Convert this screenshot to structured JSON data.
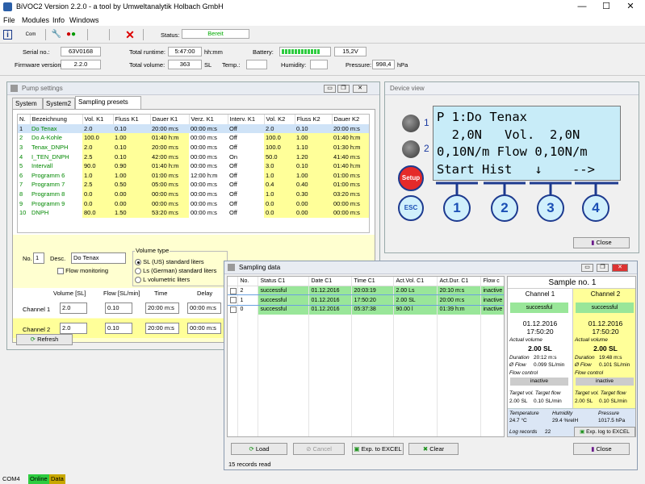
{
  "app": {
    "title": "BiVOC2 Version 2.2.0  - a tool by Umweltanalytik Holbach GmbH"
  },
  "menu": [
    "File",
    "Modules",
    "Info",
    "Windows"
  ],
  "toolbar": {
    "status_label": "Status:",
    "status_value": "Bereit",
    "com_label": "Com"
  },
  "info": {
    "serial_label": "Serial no.:",
    "serial": "63V0168",
    "firmware_label": "Firmware version:",
    "firmware": "2.2.0",
    "runtime_label": "Total runtime:",
    "runtime": "5:47:00",
    "runtime_unit": "hh:mm",
    "volume_label": "Total volume:",
    "volume": "363",
    "volume_unit": "SL",
    "battery_label": "Battery:",
    "battery_voltage": "15,2V",
    "battery_level": 0.82,
    "temp_label": "Temp.:",
    "humidity_label": "Humidity:",
    "pressure_label": "Pressure:",
    "pressure": "998,4",
    "pressure_unit": "hPa"
  },
  "pump": {
    "title": "Pump settings",
    "tabs": [
      "System",
      "System2",
      "Sampling presets"
    ],
    "headers": [
      "N.",
      "Bezeichnung",
      "Vol. K1",
      "Fluss K1",
      "Dauer K1",
      "Verz. K1",
      "Interv. K1",
      "Vol. K2",
      "Fluss K2",
      "Dauer K2"
    ],
    "rows": [
      [
        "1",
        "Do Tenax",
        "2.0",
        "0.10",
        "20:00 m:s",
        "00:00 m:s",
        "Off",
        "2.0",
        "0.10",
        "20:00 m:s"
      ],
      [
        "2",
        "Do A-Kohle",
        "100.0",
        "1.00",
        "01:40 h:m",
        "00:00 m:s",
        "Off",
        "100.0",
        "1.00",
        "01:40 h:m"
      ],
      [
        "3",
        "Tenax_DNPH",
        "2.0",
        "0.10",
        "20:00 m:s",
        "00:00 m:s",
        "Off",
        "100.0",
        "1.10",
        "01:30 h:m"
      ],
      [
        "4",
        "I_TEN_DNPH",
        "2.5",
        "0.10",
        "42:00 m:s",
        "00:00 m:s",
        "On",
        "50.0",
        "1.20",
        "41:40 m:s"
      ],
      [
        "5",
        "Intervall",
        "90.0",
        "0.90",
        "01:40 h:m",
        "00:00 m:s",
        "Off",
        "3.0",
        "0.10",
        "01:40 h:m"
      ],
      [
        "6",
        "Programm 6",
        "1.0",
        "1.00",
        "01:00 m:s",
        "12:00 h:m",
        "Off",
        "1.0",
        "1.00",
        "01:00 m:s"
      ],
      [
        "7",
        "Programm 7",
        "2.5",
        "0.50",
        "05:00 m:s",
        "00:00 m:s",
        "Off",
        "0.4",
        "0.40",
        "01:00 m:s"
      ],
      [
        "8",
        "Programm 8",
        "0.0",
        "0.00",
        "00:00 m:s",
        "00:00 m:s",
        "Off",
        "1.0",
        "0.30",
        "03:20 m:s"
      ],
      [
        "9",
        "Programm 9",
        "0.0",
        "0.00",
        "00:00 m:s",
        "00:00 m:s",
        "Off",
        "0.0",
        "0.00",
        "00:00 m:s"
      ],
      [
        "10",
        "DNPH",
        "80.0",
        "1.50",
        "53:20 m:s",
        "00:00 m:s",
        "Off",
        "0.0",
        "0.00",
        "00:00 m:s"
      ]
    ],
    "no_label": "No.",
    "no_value": "1",
    "desc_label": "Desc.",
    "desc_value": "Do Tenax",
    "flow_monitoring": "Flow monitoring",
    "voltype_label": "Volume type",
    "voltypes": [
      "SL (US) standard liters",
      "Ls (German) standard liters",
      "L  volumetric liters"
    ],
    "grid_headers": [
      "Volume  [SL]",
      "Flow [SL/min]",
      "Time",
      "Delay"
    ],
    "ch1_label": "Channel 1",
    "ch1": [
      "2.0",
      "0.10",
      "20:00 m:s",
      "00:00 m:s"
    ],
    "ch2_label": "Channel 2",
    "ch2": [
      "2.0",
      "0.10",
      "20:00 m:s",
      "00:00 m:s"
    ],
    "refresh": "Refresh"
  },
  "device": {
    "title": "Device view",
    "lcd": [
      "P 1:Do Tenax",
      "  2,0N   Vol.  2,0N",
      "0,10N/m Flow 0,10N/m",
      "Start Hist   ↓    -->"
    ],
    "led1": "1",
    "led2": "2",
    "setup": "Setup",
    "esc": "ESC",
    "buttons": [
      "1",
      "2",
      "3",
      "4"
    ],
    "close": "Close"
  },
  "sampling": {
    "title": "Sampling data",
    "headers": [
      "No.",
      "Status C1",
      "Date C1",
      "Time C1",
      "Act.Vol. C1",
      "Act.Dur. C1",
      "Flow c"
    ],
    "rows": [
      [
        "2",
        "successful",
        "01.12.2016",
        "20:03:19",
        "2.00 Ls",
        "20:10 m:s",
        "inactive"
      ],
      [
        "1",
        "successful",
        "01.12.2016",
        "17:50:20",
        "2.00 SL",
        "20:00 m:s",
        "inactive"
      ],
      [
        "0",
        "successful",
        "01.12.2016",
        "05:37:38",
        "90.00 l",
        "01:39 h:m",
        "inactive"
      ]
    ],
    "load": "Load",
    "cancel": "Cancel",
    "excel": "Exp. to EXCEL",
    "clear": "Clear",
    "records": "15 records read",
    "sample_title": "Sample no. 1",
    "ch1": {
      "name": "Channel 1",
      "status": "successful",
      "date": "01.12.2016",
      "time": "17:50:20",
      "actvol_label": "Actual volume",
      "actvol": "2.00 SL",
      "dur_label": "Duration",
      "dur": "20:12 m:s",
      "flow_label": "Ø Flow",
      "flow": "0.099 SL/min",
      "fc_label": "Flow control",
      "fc": "inactive",
      "target_label": "Target vol. Target flow",
      "tv": "2.00 SL",
      "tf": "0.10 SL/min"
    },
    "ch2": {
      "name": "Channel 2",
      "status": "successful",
      "date": "01.12.2016",
      "time": "17:50:20",
      "actvol_label": "Actual volume",
      "actvol": "2.00 SL",
      "dur_label": "Duration",
      "dur": "19:48 m:s",
      "flow_label": "Ø Flow",
      "flow": "0.101 SL/min",
      "fc_label": "Flow control",
      "fc": "inactive",
      "target_label": "Target vol. Target flow",
      "tv": "2.00 SL",
      "tf": "0.10 SL/min"
    },
    "env": {
      "temp_label": "Temperature",
      "temp": "24.7 °C",
      "hum_label": "Humidity",
      "hum": "29.4 %relH",
      "pres_label": "Pressure",
      "pres": "1017.5 hPa",
      "log_label": "Log records",
      "log": "22",
      "exp_log": "Exp. log to EXCEL",
      "close": "Close"
    }
  },
  "statusbar": {
    "port": "COM4",
    "online": "Online",
    "data": "Data"
  },
  "colors": {
    "yellow": "#ffff99",
    "green": "#99e699",
    "lcd": "#c8ecf8",
    "select": "#cfe3f7"
  }
}
